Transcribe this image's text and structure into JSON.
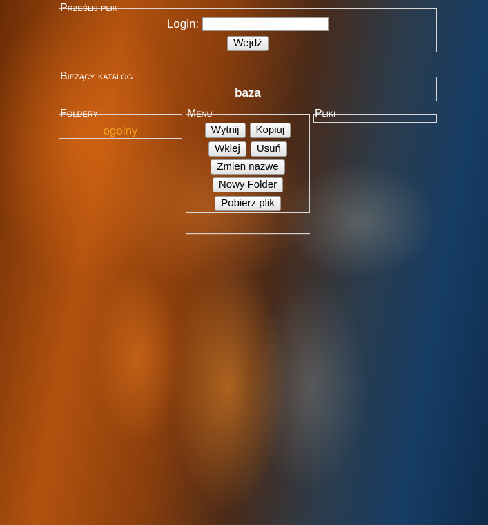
{
  "upload": {
    "legend": "Prześlij plik",
    "login_label": "Login:",
    "login_value": "",
    "enter_label": "Wejdź"
  },
  "current_dir": {
    "legend": "Biezący katalog",
    "value": "baza"
  },
  "folders": {
    "legend": "Foldery",
    "items": [
      "ogolny"
    ]
  },
  "menu": {
    "legend": "Menu",
    "buttons": {
      "cut": "Wytnij",
      "copy": "Kopiuj",
      "paste": "Wklej",
      "delete": "Usuń",
      "rename": "Zmien nazwe",
      "new_folder": "Nowy Folder",
      "download": "Pobierz plik"
    }
  },
  "files": {
    "legend": "Pliki"
  },
  "colors": {
    "folder_link": "#f0a020",
    "panel_border": "#d8d8d8"
  }
}
